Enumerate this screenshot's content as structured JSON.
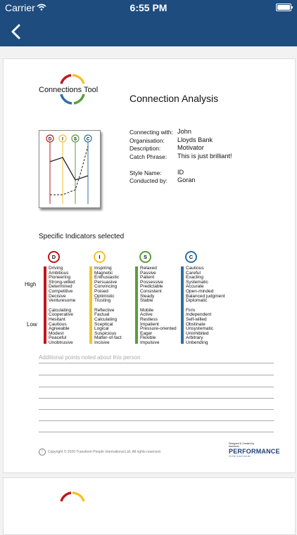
{
  "status": {
    "carrier": "Carrier",
    "time": "6:55 PM"
  },
  "report": {
    "logo_text": "Connections Tool",
    "title": "Connection Analysis",
    "info": [
      {
        "label": "Connecting with:",
        "value": "John"
      },
      {
        "label": "Organisation:",
        "value": "Lloyds Bank"
      },
      {
        "label": "Description:",
        "value": "Motivator"
      },
      {
        "label": "Catch Phrase:",
        "value": "This is just brilliant!"
      },
      {
        "label": "",
        "value": ""
      },
      {
        "label": "Style Name:",
        "value": "ID"
      },
      {
        "label": "Conducted by:",
        "value": "Goran"
      }
    ],
    "chart_letters": [
      "D",
      "I",
      "S",
      "C"
    ],
    "specific_title": "Specific Indicators selected",
    "high_label": "High",
    "low_label": "Low",
    "columns": [
      {
        "letter": "D",
        "color": "#c0161e",
        "high": [
          "Driving",
          "Ambitious",
          "Pioneering",
          "Strong-willed",
          "Determined",
          "Competitive",
          "Decisive",
          "Venturesome"
        ],
        "low": [
          "Calculating",
          "Cooperative",
          "Hesitant",
          "Cautious",
          "Agreeable",
          "Modest",
          "Peaceful",
          "Unobtrusive"
        ]
      },
      {
        "letter": "I",
        "color": "#f4c22b",
        "high": [
          "Inspiring",
          "Magnetic",
          "Enthusiastic",
          "Persuasive",
          "Convincing",
          "Poised",
          "Optimistic",
          "Trusting"
        ],
        "low": [
          "Reflective",
          "Factual",
          "Calculating",
          "Sceptical",
          "Logical",
          "Suspicious",
          "Matter-of-fact",
          "Incisive"
        ]
      },
      {
        "letter": "S",
        "color": "#5a9e3a",
        "high": [
          "Relaxed",
          "Passive",
          "Patient",
          "Possessive",
          "Predictable",
          "Consistent",
          "Steady",
          "Stable"
        ],
        "low": [
          "Mobile",
          "Active",
          "Restless",
          "Impatient",
          "Pressure-oriented",
          "Eager",
          "Flexible",
          "Impulsive"
        ]
      },
      {
        "letter": "C",
        "color": "#2d6fa6",
        "high": [
          "Cautious",
          "Careful",
          "Exacting",
          "Systematic",
          "Accurate",
          "Open-minded",
          "Balanced judgment",
          "Diplomatic"
        ],
        "low": [
          "Firm",
          "Independent",
          "Self-willed",
          "Obstinate",
          "Unsystematic",
          "Uninhibited",
          "Arbitrary",
          "Unbending"
        ]
      }
    ],
    "notes_label": "Additional points noted about this person",
    "copyright": "Copyright © 2020 Transform People International Ltd. All rights reserved.",
    "designed_by": "Designed & Created by",
    "brand_line1": "transform",
    "brand_line2": "PERFORMANCE",
    "brand_line3": "international"
  },
  "colors": {
    "nav": "#1e4c7e",
    "d": "#c0161e",
    "i": "#f4c22b",
    "s": "#5a9e3a",
    "c": "#2d6fa6"
  }
}
